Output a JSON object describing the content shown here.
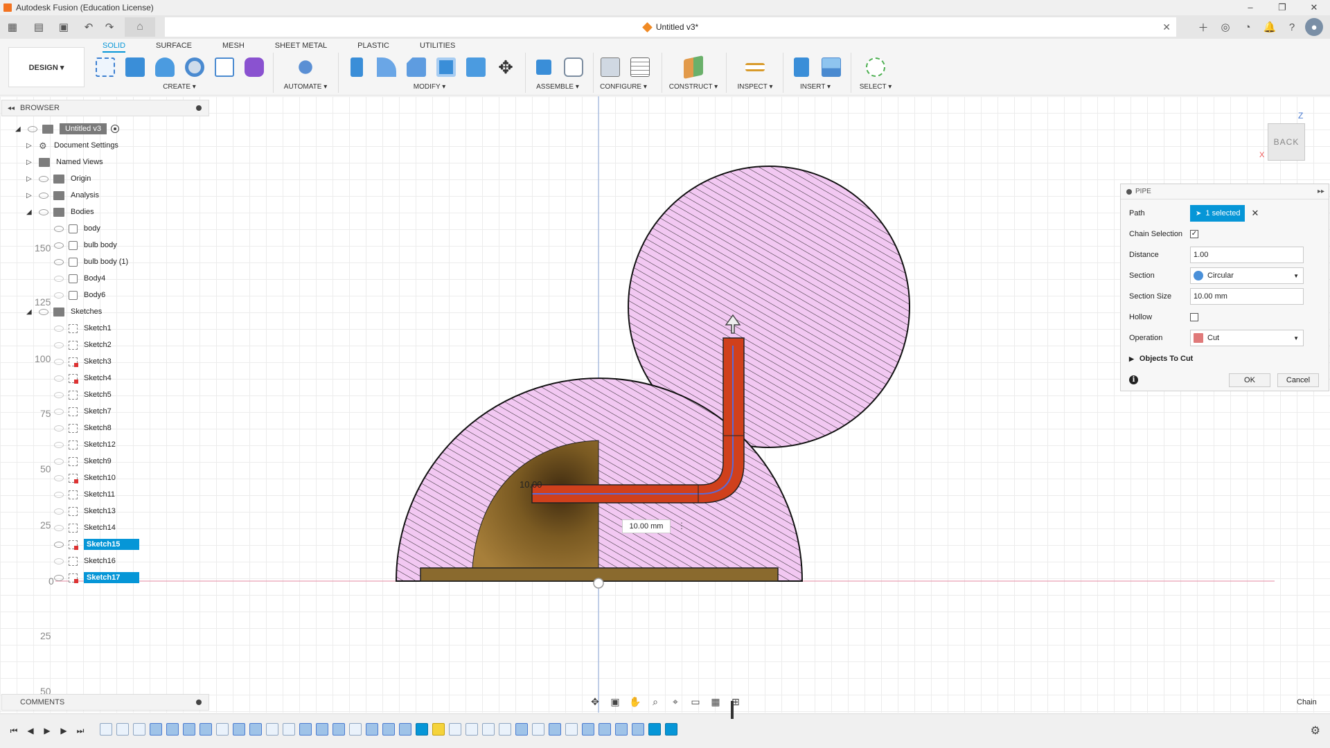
{
  "window": {
    "title": "Autodesk Fusion (Education License)",
    "controls": [
      "–",
      "❐",
      "✕"
    ]
  },
  "document_tab": {
    "title": "Untitled v3*",
    "close": "✕"
  },
  "ribbon": {
    "design_button": "DESIGN ▾",
    "tabs": [
      "SOLID",
      "SURFACE",
      "MESH",
      "SHEET METAL",
      "PLASTIC",
      "UTILITIES"
    ],
    "groups": [
      "CREATE ▾",
      "AUTOMATE ▾",
      "MODIFY ▾",
      "ASSEMBLE ▾",
      "CONFIGURE ▾",
      "CONSTRUCT ▾",
      "INSPECT ▾",
      "INSERT ▾",
      "SELECT ▾"
    ]
  },
  "browser": {
    "header": "BROWSER",
    "root": "Untitled v3",
    "folders": [
      "Document Settings",
      "Named Views",
      "Origin",
      "Analysis",
      "Bodies"
    ],
    "bodies": [
      "body",
      "bulb body",
      "bulb body (1)",
      "Body4",
      "Body6"
    ],
    "sketches_label": "Sketches",
    "sketches": [
      "Sketch1",
      "Sketch2",
      "Sketch3",
      "Sketch4",
      "Sketch5",
      "Sketch7",
      "Sketch8",
      "Sketch12",
      "Sketch9",
      "Sketch10",
      "Sketch11",
      "Sketch13",
      "Sketch14",
      "Sketch15",
      "Sketch16",
      "Sketch17"
    ],
    "selected": [
      "Sketch15",
      "Sketch17"
    ]
  },
  "canvas": {
    "ruler_numbers": [
      "150",
      "125",
      "100",
      "75",
      "50",
      "25",
      "0",
      "25",
      "50"
    ],
    "dimension_label": "10.00",
    "dimension_input": "10.00 mm",
    "dimension_more": "⋮",
    "view_cube_face": "BACK",
    "axis_z": "Z",
    "axis_x": "X"
  },
  "pipe_panel": {
    "title": "PIPE",
    "path_label": "Path",
    "path_value": "1 selected",
    "chain_selection_label": "Chain Selection",
    "chain_selection_checked": true,
    "distance_label": "Distance",
    "distance_value": "1.00",
    "section_label": "Section",
    "section_value": "Circular",
    "section_size_label": "Section Size",
    "section_size_value": "10.00 mm",
    "hollow_label": "Hollow",
    "hollow_checked": false,
    "operation_label": "Operation",
    "operation_value": "Cut",
    "objects_to_cut_label": "Objects To Cut",
    "ok": "OK",
    "cancel": "Cancel"
  },
  "comments": {
    "header": "COMMENTS"
  },
  "status": {
    "selection_mode": "Chain"
  },
  "colors": {
    "accent": "#0696d7",
    "hatch_fill": "#f2c8f2",
    "pipe": "#d0401c",
    "base": "#8a6a2e"
  }
}
